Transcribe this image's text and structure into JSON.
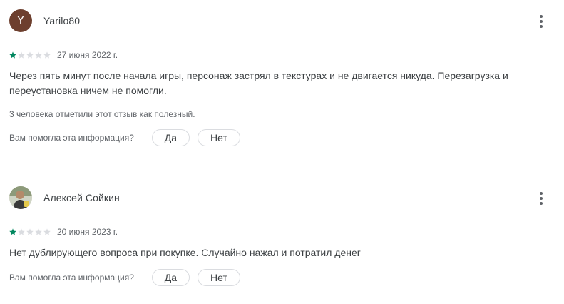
{
  "reviews": [
    {
      "author": "Yarilo80",
      "avatar_letter": "Y",
      "avatar_color": "#6d3f2e",
      "rating": 1,
      "max_rating": 5,
      "date": "27 июня 2022 г.",
      "text": "Через пять минут после начала игры, персонаж застрял в текстурах и не двигается никуда. Перезагрузка и переустановка ничем не помогли.",
      "helpful_count_text": "3 человека отметили этот отзыв как полезный.",
      "feedback_question": "Вам помогла эта информация?",
      "yes_label": "Да",
      "no_label": "Нет"
    },
    {
      "author": "Алексей Сойкин",
      "avatar_type": "photo",
      "rating": 1,
      "max_rating": 5,
      "date": "20 июня 2023 г.",
      "text": "Нет дублирующего вопроса при покупке. Случайно нажал и потратил денег",
      "feedback_question": "Вам помогла эта информация?",
      "yes_label": "Да",
      "no_label": "Нет"
    }
  ],
  "colors": {
    "star_filled": "#01875f",
    "star_empty": "#dadce0"
  },
  "icons": {
    "more": "more-vert-icon",
    "star": "star-icon"
  }
}
